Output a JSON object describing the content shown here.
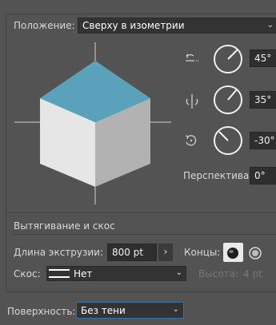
{
  "position": {
    "label": "Положение:",
    "value": "Сверху в изометрии",
    "x_rotation": "45°",
    "y_rotation": "35°",
    "z_rotation": "-30°",
    "perspective_label": "Перспектива:",
    "perspective_value": "0°"
  },
  "extrude": {
    "section_title": "Вытягивание и скос",
    "depth_label": "Длина экструзии:",
    "depth_value": "800 pt",
    "caps_label": "Концы:",
    "bevel_label": "Скос:",
    "bevel_value": "Нет",
    "height_label": "Высота:",
    "height_value": "4 pt"
  },
  "surface": {
    "label": "Поверхность:",
    "value": "Без тени"
  },
  "colors": {
    "cube_top": "#5aa2bb",
    "cube_left": "#e6e6e6",
    "cube_right": "#b2b2b2"
  },
  "icons": {
    "x_axis": "rotate-x-icon",
    "y_axis": "rotate-y-icon",
    "z_axis": "rotate-z-icon",
    "caps_on": "cap-on-icon",
    "caps_off": "cap-off-icon"
  }
}
